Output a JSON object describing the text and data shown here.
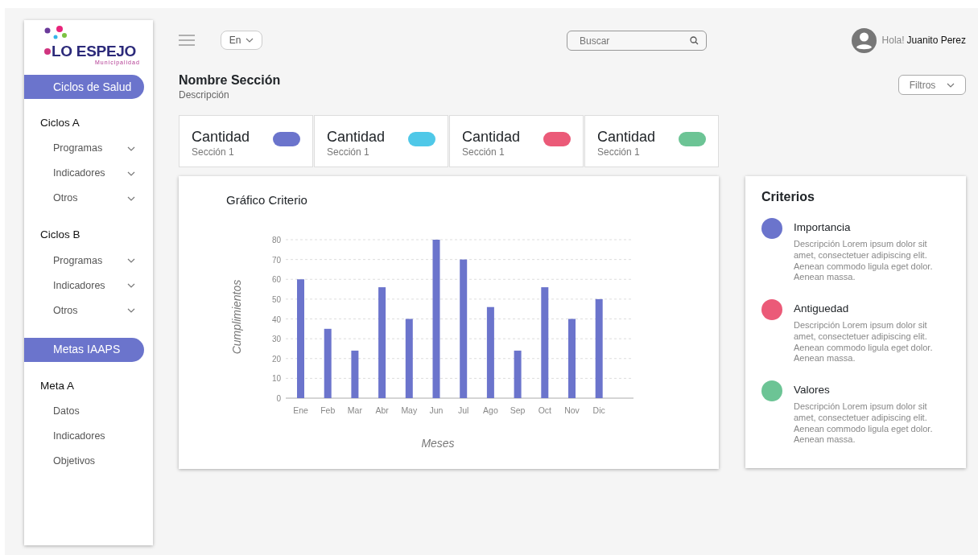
{
  "logo": {
    "name": "LO ESPEJO",
    "subtitle": "Municipalidad"
  },
  "sidebar": {
    "sections": [
      {
        "title": "Ciclos de Salud",
        "groups": [
          {
            "title": "Ciclos A",
            "items": [
              {
                "label": "Programas",
                "kind": "submenu"
              },
              {
                "label": "Indicadores",
                "kind": "submenu"
              },
              {
                "label": "Otros",
                "kind": "submenu"
              }
            ]
          },
          {
            "title": "Ciclos B",
            "items": [
              {
                "label": "Programas",
                "kind": "submenu"
              },
              {
                "label": "Indicadores",
                "kind": "submenu"
              },
              {
                "label": "Otros",
                "kind": "submenu"
              }
            ]
          }
        ]
      },
      {
        "title": "Metas IAAPS",
        "groups": [
          {
            "title": "Meta A",
            "items": [
              {
                "label": "Datos",
                "kind": "link"
              },
              {
                "label": "Indicadores",
                "kind": "link"
              },
              {
                "label": "Objetivos",
                "kind": "link"
              }
            ]
          }
        ]
      }
    ]
  },
  "header": {
    "language": "En",
    "search": {
      "placeholder": "Buscar"
    },
    "greeting": "Hola!",
    "user": "Juanito Perez"
  },
  "section": {
    "title": "Nombre Sección",
    "description": "Descripción",
    "filter": "Filtros"
  },
  "stats": [
    {
      "title": "Cantidad",
      "subtitle": "Sección 1",
      "color": "#6b74cc"
    },
    {
      "title": "Cantidad",
      "subtitle": "Sección 1",
      "color": "#4fc8e8"
    },
    {
      "title": "Cantidad",
      "subtitle": "Sección 1",
      "color": "#eb5a78"
    },
    {
      "title": "Cantidad",
      "subtitle": "Sección 1",
      "color": "#6cc495"
    }
  ],
  "chart": {
    "chart_data": {
      "type": "bar",
      "title": "Gráfico Criterio",
      "xlabel": "Meses",
      "ylabel": "Cumplimientos",
      "categories": [
        "Ene",
        "Feb",
        "Mar",
        "Abr",
        "May",
        "Jun",
        "Jul",
        "Ago",
        "Sep",
        "Oct",
        "Nov",
        "Dic"
      ],
      "grid": true,
      "series": [
        {
          "color": "#6b74cc",
          "values": [
            60,
            35,
            24,
            56,
            40,
            80,
            70,
            46,
            24,
            56,
            40,
            50
          ]
        }
      ],
      "ylim": [
        0,
        80
      ],
      "yticks": [
        0,
        10,
        20,
        30,
        40,
        50,
        60,
        70,
        80
      ]
    }
  },
  "criteria": {
    "title": "Criterios",
    "items": [
      {
        "name": "Importancia",
        "description": "Descripción Lorem ipsum dolor sit amet, consectetuer adipiscing elit. Aenean commodo ligula eget dolor. Aenean massa.",
        "color": "#6b74cc"
      },
      {
        "name": "Antiguedad",
        "description": "Descripción Lorem ipsum dolor sit amet, consectetuer adipiscing elit. Aenean commodo ligula eget dolor. Aenean massa.",
        "color": "#eb5a78"
      },
      {
        "name": "Valores",
        "description": "Descripción Lorem ipsum dolor sit amet, consectetuer adipiscing elit. Aenean commodo ligula eget dolor. Aenean massa.",
        "color": "#6cc495"
      }
    ]
  }
}
